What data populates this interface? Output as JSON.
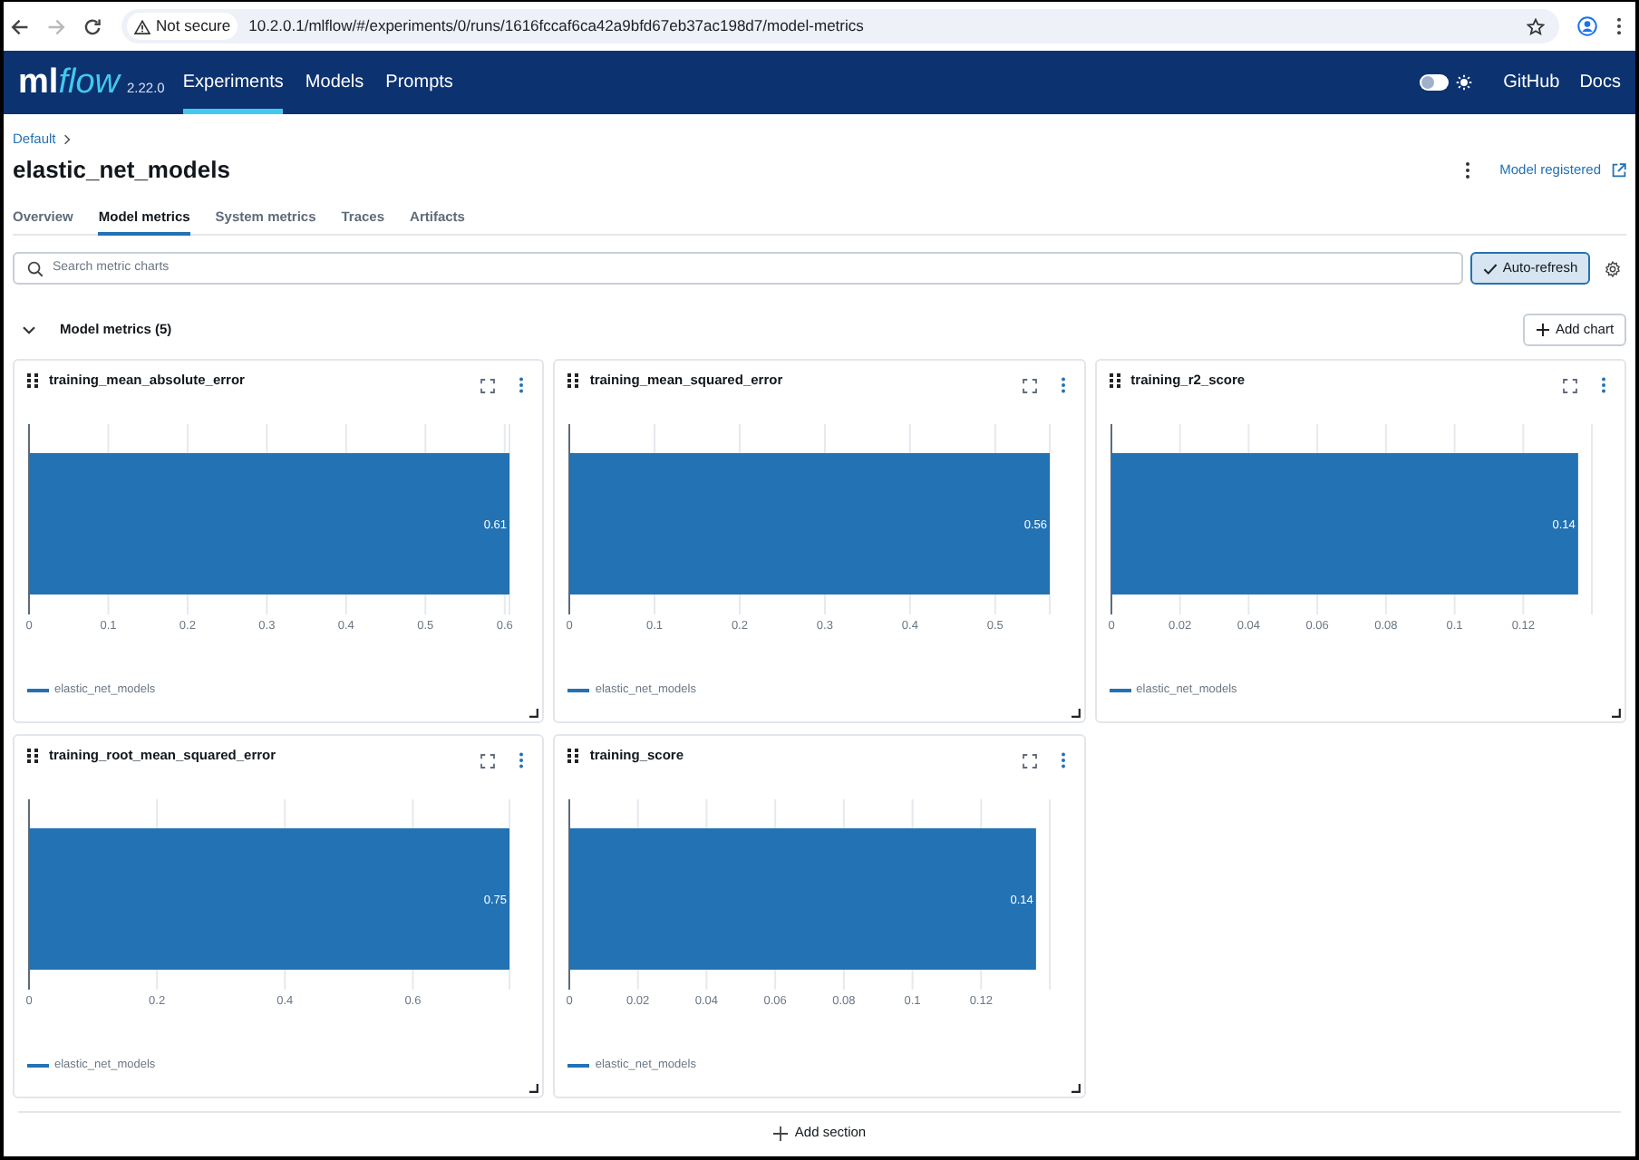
{
  "browser": {
    "forward_button": {
      "disabled": true
    },
    "security_label": "Not secure",
    "url": "10.2.0.1/mlflow/#/experiments/0/runs/1616fccaf6ca42a9bfd67eb37ac198d7/model-metrics"
  },
  "header": {
    "logo": {
      "parts": [
        "ml",
        "flow"
      ]
    },
    "version": "2.22.0",
    "nav": [
      {
        "label": "Experiments",
        "selected": true
      },
      {
        "label": "Models",
        "selected": false
      },
      {
        "label": "Prompts",
        "selected": false
      }
    ],
    "theme_toggle": {
      "on": false
    },
    "links": [
      "GitHub",
      "Docs"
    ]
  },
  "breadcrumb": [
    "Default"
  ],
  "run": {
    "title": "elastic_net_models",
    "model_link": "Model registered"
  },
  "tabs": [
    {
      "label": "Overview",
      "selected": false
    },
    {
      "label": "Model metrics",
      "selected": true
    },
    {
      "label": "System metrics",
      "selected": false
    },
    {
      "label": "Traces",
      "selected": false
    },
    {
      "label": "Artifacts",
      "selected": false
    }
  ],
  "search": {
    "placeholder": "Search metric charts"
  },
  "auto_refresh": {
    "label": "Auto-refresh",
    "on": true
  },
  "section": {
    "title": "Model metrics (5)",
    "expanded": true,
    "add_chart": "Add chart",
    "charts": [
      {
        "title": "training_mean_absolute_error",
        "chart_data": {
          "type": "bar",
          "orientation": "horizontal",
          "grid": true,
          "series": [
            {
              "name": "elastic_net_models",
              "color": "#2272b4",
              "values": [
                0.606
              ]
            }
          ],
          "xlim": [
            0,
            0.606
          ],
          "xticks": [
            0,
            0.1,
            0.2,
            0.3,
            0.4,
            0.5,
            0.6
          ],
          "value_labels": [
            "0.61"
          ]
        }
      },
      {
        "title": "training_mean_squared_error",
        "chart_data": {
          "type": "bar",
          "orientation": "horizontal",
          "grid": true,
          "series": [
            {
              "name": "elastic_net_models",
              "color": "#2272b4",
              "values": [
                0.564
              ]
            }
          ],
          "xlim": [
            0,
            0.564
          ],
          "xticks": [
            0,
            0.1,
            0.2,
            0.3,
            0.4,
            0.5
          ],
          "value_labels": [
            "0.56"
          ]
        }
      },
      {
        "title": "training_r2_score",
        "chart_data": {
          "type": "bar",
          "orientation": "horizontal",
          "grid": true,
          "series": [
            {
              "name": "elastic_net_models",
              "color": "#2272b4",
              "values": [
                0.136
              ]
            }
          ],
          "xlim": [
            0,
            0.14
          ],
          "xticks": [
            0,
            0.02,
            0.04,
            0.06,
            0.08,
            0.1,
            0.12
          ],
          "value_labels": [
            "0.14"
          ]
        }
      },
      {
        "title": "training_root_mean_squared_error",
        "chart_data": {
          "type": "bar",
          "orientation": "horizontal",
          "grid": true,
          "series": [
            {
              "name": "elastic_net_models",
              "color": "#2272b4",
              "values": [
                0.751
              ]
            }
          ],
          "xlim": [
            0,
            0.751
          ],
          "xticks": [
            0,
            0.2,
            0.4,
            0.6
          ],
          "value_labels": [
            "0.75"
          ]
        }
      },
      {
        "title": "training_score",
        "chart_data": {
          "type": "bar",
          "orientation": "horizontal",
          "grid": true,
          "series": [
            {
              "name": "elastic_net_models",
              "color": "#2272b4",
              "values": [
                0.136
              ]
            }
          ],
          "xlim": [
            0,
            0.14
          ],
          "xticks": [
            0,
            0.02,
            0.04,
            0.06,
            0.08,
            0.1,
            0.12
          ],
          "value_labels": [
            "0.14"
          ]
        }
      }
    ]
  },
  "add_section": "Add section"
}
